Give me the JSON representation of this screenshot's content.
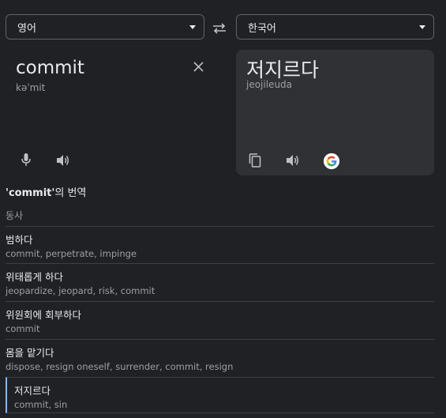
{
  "source_lang": {
    "label": "영어"
  },
  "target_lang": {
    "label": "한국어"
  },
  "source": {
    "word": "commit",
    "phonetic": "kəˈmit"
  },
  "target": {
    "word": "저지르다",
    "romanization": "jeojileuda"
  },
  "section": {
    "title_quote": "'commit'",
    "title_rest": "의 번역",
    "pos": "동사"
  },
  "entries": [
    {
      "translation": "범하다",
      "synonyms": "commit, perpetrate, impinge"
    },
    {
      "translation": "위태롭게 하다",
      "synonyms": "jeopardize, jeopard, risk, commit"
    },
    {
      "translation": "위원회에 회부하다",
      "synonyms": "commit"
    },
    {
      "translation": "몸을 맡기다",
      "synonyms": "dispose, resign oneself, surrender, commit, resign"
    },
    {
      "translation": "저지르다",
      "synonyms": "commit, sin"
    }
  ],
  "colors": {
    "accent": "#8ab4f8",
    "bg": "#202124",
    "card": "#303134"
  }
}
